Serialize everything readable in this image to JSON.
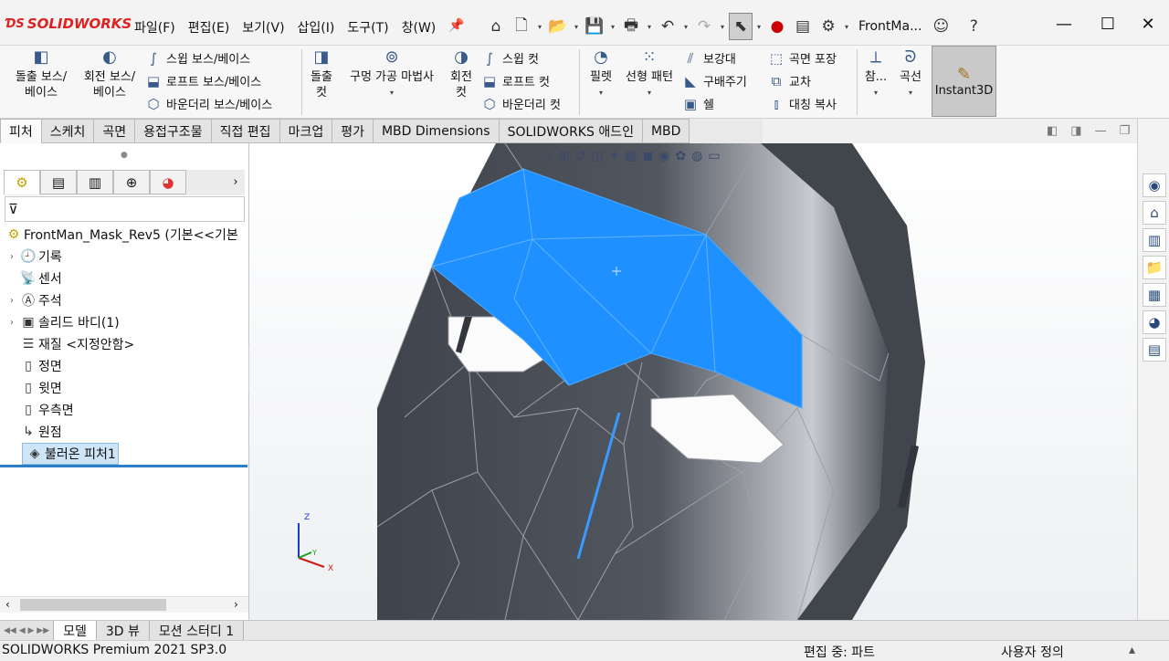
{
  "app": {
    "logo_text": "SOLIDWORKS",
    "brand_color": "#d22222"
  },
  "menu": [
    "파일(F)",
    "편집(E)",
    "보기(V)",
    "삽입(I)",
    "도구(T)",
    "창(W)"
  ],
  "window": {
    "doc_title": "FrontMa...",
    "min_icon": "minimize-icon",
    "max_icon": "maximize-icon",
    "close_icon": "close-icon"
  },
  "commands": {
    "extrude_boss": "돌출 보스/\n베이스",
    "revolve_boss": "회전 보스/\n베이스",
    "sweep_boss": "스윕 보스/베이스",
    "loft_boss": "로프트 보스/베이스",
    "boundary_boss": "바운더리 보스/베이스",
    "extrude_cut": "돌출\n컷",
    "hole_wizard": "구멍 가공 마법사",
    "revolve_cut": "회전\n컷",
    "sweep_cut": "스윕 컷",
    "loft_cut": "로프트 컷",
    "boundary_cut": "바운더리 컷",
    "fillet": "필렛",
    "linear_pattern": "선형 패턴",
    "rib": "보강대",
    "draft": "구배주기",
    "shell": "쉘",
    "wrap": "곡면 포장",
    "intersect": "교차",
    "mirror": "대칭 복사",
    "reference": "참...",
    "curves": "곡선",
    "instant3d": "Instant3D"
  },
  "tabs": [
    "피처",
    "스케치",
    "곡면",
    "용접구조물",
    "직접 편집",
    "마크업",
    "평가",
    "MBD Dimensions",
    "SOLIDWORKS 애드인",
    "MBD"
  ],
  "active_tab": "피처",
  "tree": {
    "root": "FrontMan_Mask_Rev5  (기본<<기본",
    "items": [
      {
        "label": "기록",
        "icon": "history-icon",
        "expand": true
      },
      {
        "label": "센서",
        "icon": "sensor-icon",
        "expand": false
      },
      {
        "label": "주석",
        "icon": "annotation-icon",
        "expand": true
      },
      {
        "label": "솔리드 바디(1)",
        "icon": "solid-body-icon",
        "expand": true
      },
      {
        "label": "재질 <지정안함>",
        "icon": "material-icon",
        "expand": false
      },
      {
        "label": "정면",
        "icon": "plane-icon",
        "expand": false
      },
      {
        "label": "윗면",
        "icon": "plane-icon",
        "expand": false
      },
      {
        "label": "우측면",
        "icon": "plane-icon",
        "expand": false
      },
      {
        "label": "원점",
        "icon": "origin-icon",
        "expand": false
      },
      {
        "label": "불러온 피처1",
        "icon": "imported-feature-icon",
        "expand": false
      }
    ]
  },
  "triad": {
    "x": "X",
    "y": "Y",
    "z": "Z"
  },
  "bottom_tabs": [
    "모델",
    "3D 뷰",
    "모션 스터디 1"
  ],
  "status": {
    "product": "SOLIDWORKS Premium 2021 SP3.0",
    "mode": "편집 중: 파트",
    "custom": "사용자 정의"
  },
  "colors": {
    "mask": "#4b4f58",
    "selected_face": "#1e90ff"
  }
}
